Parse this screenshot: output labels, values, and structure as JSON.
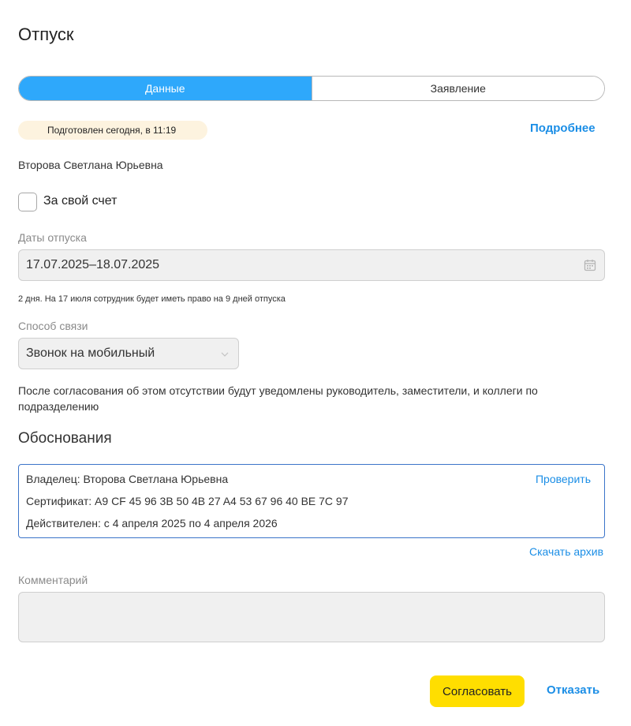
{
  "page": {
    "title": "Отпуск"
  },
  "tabs": [
    {
      "label": "Данные",
      "active": true
    },
    {
      "label": "Заявление",
      "active": false
    }
  ],
  "status": {
    "text": "Подготовлен сегодня, в 11:19"
  },
  "details_link": "Подробнее",
  "employee_name": "Второва Светлана Юрьевна",
  "own_expense": {
    "label": "За свой счет",
    "checked": false
  },
  "vacation_dates": {
    "label": "Даты отпуска",
    "value": "17.07.2025–18.07.2025",
    "icon": "calendar-icon"
  },
  "hint": "2 дня. На 17 июля сотрудник будет иметь право на 9 дней отпуска",
  "contact_method": {
    "label": "Способ связи",
    "value": "Звонок на мобильный",
    "icon": "chevron-down-icon"
  },
  "notice": "После согласования об этом отсутствии будут уведомлены руководитель, заместители, и коллеги по подразделению",
  "justification": {
    "title": "Обоснования",
    "owner": "Владелец: Второва Светлана Юрьевна",
    "certificate": "Сертификат: A9 CF 45 96 3B 50 4B 27 A4 53 67 96 40 BE 7C 97",
    "valid": "Действителен: с 4 апреля 2025 по 4 апреля 2026",
    "verify_label": "Проверить",
    "download_label": "Скачать архив"
  },
  "comment": {
    "label": "Комментарий",
    "value": ""
  },
  "actions": {
    "approve_label": "Согласовать",
    "reject_label": "Отказать"
  },
  "colors": {
    "accent": "#2ea8fb",
    "link": "#1b8ee6",
    "approve": "#ffde00",
    "status_badge_bg": "#fdf3df",
    "cert_border": "#3b74c9"
  }
}
